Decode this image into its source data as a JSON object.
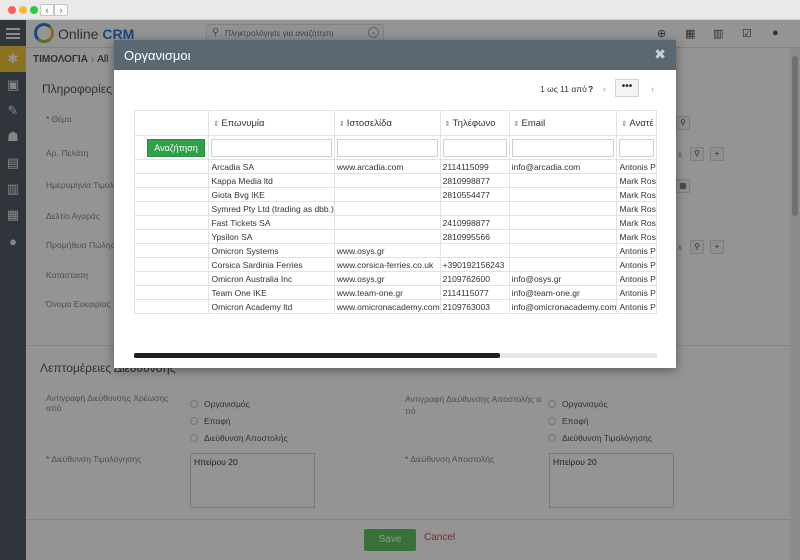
{
  "app": {
    "logo_text_a": "Online ",
    "logo_text_b": "CRM"
  },
  "header": {
    "search_placeholder": "Πληκτρολόγησε για αναζήτηση",
    "icons": [
      "plus-circle-icon",
      "calendar-icon",
      "chart-icon",
      "checkbox-icon",
      "user-icon"
    ]
  },
  "breadcrumb": {
    "module": "ΤΙΜΟΛΟΓΙΑ",
    "item": "All"
  },
  "page": {
    "section_info": "Πληροφορίες",
    "fields": [
      {
        "label": "Θέμα",
        "required": true
      },
      {
        "label": "Αρ. Πελάτη",
        "required": false
      },
      {
        "label": "Ημερομηνία Τιμολ",
        "required": false
      },
      {
        "label": "Δελτίο Αγοράς",
        "required": false
      },
      {
        "label": "Προμήθεια Πώλησ",
        "required": false
      },
      {
        "label": "Κατάσταση",
        "required": false
      },
      {
        "label": "Όνομα Ευκαιρίας",
        "required": false
      }
    ],
    "section_address": "Λεπτομέρειες Διεύθυνσης",
    "copy_billing_label": "Αντιγραφή Διεύθυνσης Χρέωσης από",
    "copy_billing_options": [
      "Οργανισμός",
      "Επαφή",
      "Διεύθυνση Αποστολής"
    ],
    "copy_shipping_label": "Αντιγραφή Διεύθυνσης Αποστολής α πό",
    "copy_shipping_options": [
      "Οργανισμός",
      "Επαφή",
      "Διεύθυνση Τιμολόγησης"
    ],
    "billing_address_label": "Διεύθυνση Τιμολόγησης",
    "billing_address_value": "Ηπείρου 20",
    "shipping_address_label": "Διεύθυνση Αποστολής",
    "shipping_address_value": "Ηπείρου 20",
    "save_label": "Save",
    "cancel_label": "Cancel"
  },
  "modal": {
    "title": "Οργανισμοι",
    "pager_text": "1 ως 11  από",
    "pager_total": "?",
    "pager_more": "•••",
    "search_button": "Αναζήτηση",
    "columns": [
      "Επωνυμία",
      "Ιστοσελίδα",
      "Τηλέφωνο",
      "Email",
      "Ανατέ"
    ],
    "rows": [
      [
        "Arcadia SA",
        "www.arcadia.com",
        "2114115099",
        "info@arcadia.com",
        "Antonis P"
      ],
      [
        "Kappa Media ltd",
        "",
        "2810998877",
        "",
        "Mark Ros"
      ],
      [
        "Giota Bvg IKE",
        "",
        "2810554477",
        "",
        "Mark Ros"
      ],
      [
        "Symred Pty Ltd (trading as dbb.)",
        "",
        "",
        "",
        "Mark Ros"
      ],
      [
        "Fast Tickets SA",
        "",
        "2410998877",
        "",
        "Mark Ros"
      ],
      [
        "Ypsilon SA",
        "",
        "2810995566",
        "",
        "Mark Ros"
      ],
      [
        "Omicron Systems",
        "www.osys.gr",
        "",
        "",
        "Antonis P"
      ],
      [
        "Corsica Sardinia Ferries",
        "www.corsica-ferries.co.uk",
        "+390192156243",
        "",
        "Antonis P"
      ],
      [
        "Omicron Australia Inc",
        "www.osys.gr",
        "2109762600",
        "info@osys.gr",
        "Antonis P"
      ],
      [
        "Team One IKE",
        "www.team-one.gr",
        "2114115077",
        "info@team-one.gr",
        "Antonis P"
      ],
      [
        "Omicron Academy ltd",
        "www.omicronacademy.com",
        "2109763003",
        "info@omicronacademy.com",
        "Antonis P"
      ]
    ]
  }
}
